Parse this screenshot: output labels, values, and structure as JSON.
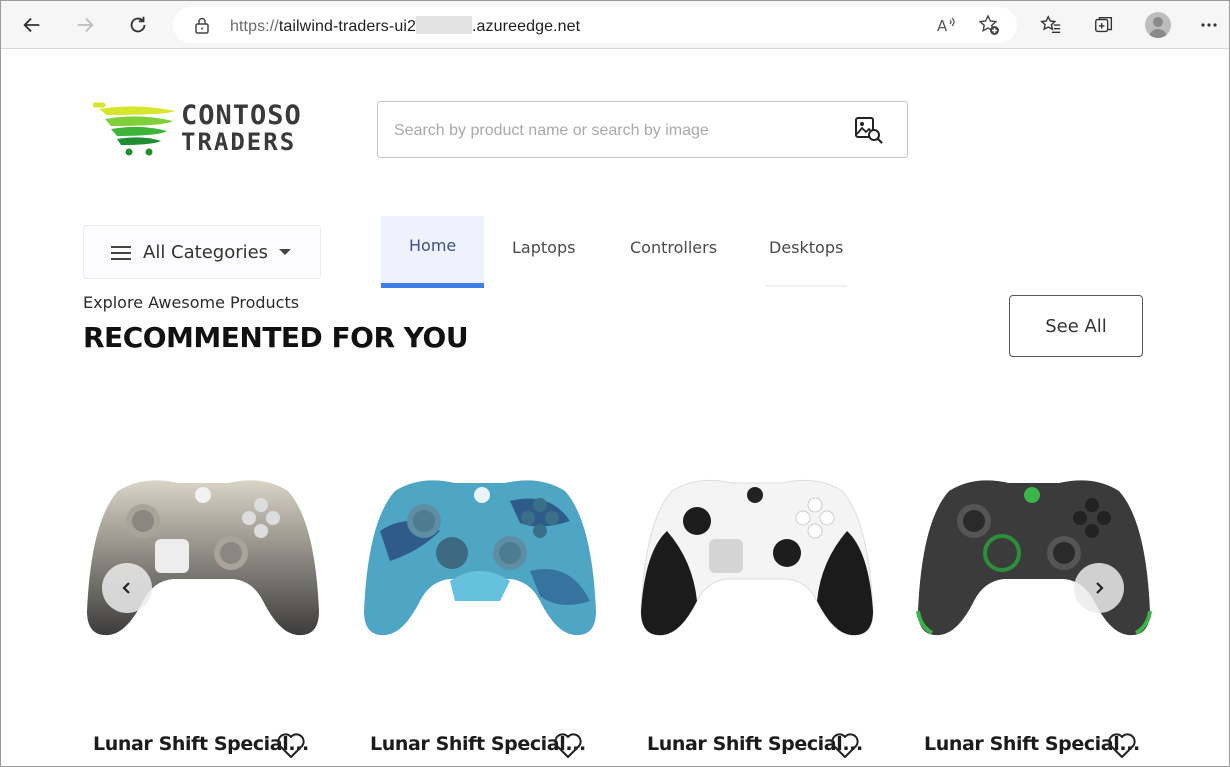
{
  "browser": {
    "url_prefix": "https://",
    "url_host_start": "tailwind-traders-ui2",
    "url_host_end": ".azureedge.net"
  },
  "logo": {
    "line1": "CONTOSO",
    "line2": "TRADERS"
  },
  "search": {
    "placeholder": "Search by product name or search by image",
    "value": ""
  },
  "categories": {
    "label": "All Categories"
  },
  "tabs": [
    {
      "label": "Home",
      "active": true
    },
    {
      "label": "Laptops",
      "active": false
    },
    {
      "label": "Controllers",
      "active": false
    },
    {
      "label": "Desktops",
      "active": false
    }
  ],
  "section": {
    "subtitle": "Explore Awesome Products",
    "title": "RECOMMENTED FOR YOU",
    "see_all_label": "See All"
  },
  "products": [
    {
      "name": "Lunar Shift Special...",
      "color": "#c9c3b4"
    },
    {
      "name": "Lunar Shift Special...",
      "color": "#4fa6c4"
    },
    {
      "name": "Lunar Shift Special...",
      "color": "#f2f2f2"
    },
    {
      "name": "Lunar Shift Special...",
      "color": "#3b3b3b"
    }
  ],
  "colors": {
    "accent": "#3d7ee8",
    "active_tab_bg": "#eef2fc",
    "logo_green": "#3fb43a",
    "logo_yellow": "#d7e52c"
  }
}
